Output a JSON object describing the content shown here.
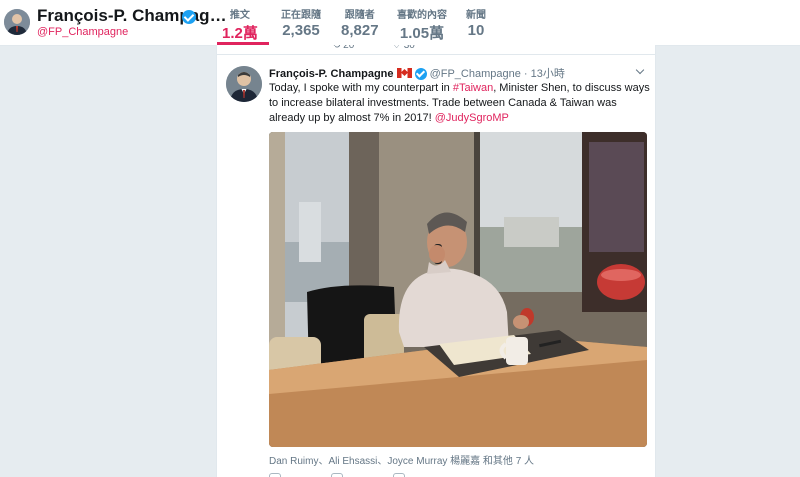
{
  "profile": {
    "name": "François-P. Champag…",
    "handle": "@FP_Champagne"
  },
  "stats": [
    {
      "label": "推文",
      "value": "1.2萬"
    },
    {
      "label": "正在跟隨",
      "value": "2,365"
    },
    {
      "label": "跟隨者",
      "value": "8,827"
    },
    {
      "label": "喜歡的內容",
      "value": "1.05萬"
    },
    {
      "label": "新聞",
      "value": "10"
    }
  ],
  "previous_tweet": {
    "retweets": "20",
    "likes": "30"
  },
  "tweet": {
    "author_name": "François-P. Champagne",
    "author_handle": "@FP_Champagne",
    "separator": "·",
    "time": "13小時",
    "text_1": "Today, I spoke with my counterpart in ",
    "hashtag": "#Taiwan",
    "text_2": ", Minister Shen, to discuss ways to increase bilateral investments. Trade between Canada & Taiwan was already up by almost 7% in 2017! ",
    "mention": "@JudySgroMP",
    "tagged_people": "Dan Ruimy、Ali Ehsassi、Joyce Murray 楊麗嘉 和其他 7 人"
  },
  "colors": {
    "accent": "#e0245e",
    "verified": "#1da1f2",
    "background": "#e6ecf0"
  },
  "icons": {
    "verified": "verified-badge-icon",
    "flag": "canada-flag-icon",
    "caret": "chevron-down-icon",
    "retweet": "retweet-icon",
    "like": "heart-icon"
  }
}
